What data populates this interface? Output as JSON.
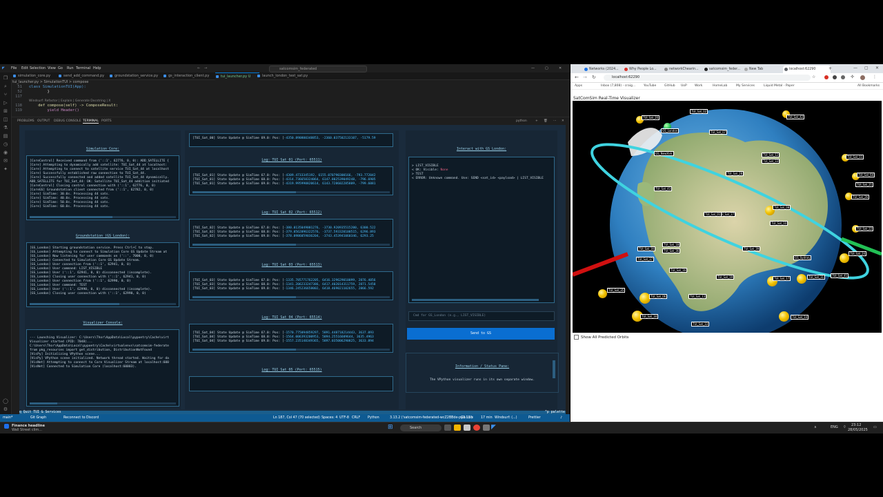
{
  "vscode": {
    "menu": [
      "File",
      "Edit",
      "Selection",
      "View",
      "Go",
      "Run",
      "Terminal",
      "Help"
    ],
    "search_placeholder": "satcomsim_federated",
    "tabs": [
      "simulation_core.py",
      "send_add_command.py",
      "groundstation_service.py",
      "gs_interaction_client.py",
      "tui_launcher.py U",
      "launch_london_test_sat.py"
    ],
    "breadcrumb": "tui_launcher.py > SimulationTUI > compose",
    "code_lines": [
      {
        "n": "51",
        "text": "class SimulationTUI(App):"
      },
      {
        "n": "52",
        "text": "        }"
      },
      {
        "n": "117",
        "text": ""
      },
      {
        "n": "",
        "text": "Windsurf: Refactor | Explain | Generate Docstring | X"
      },
      {
        "n": "118",
        "text": "    def compose(self) -> ComposeResult:"
      },
      {
        "n": "119",
        "text": "        yield Header()"
      }
    ],
    "panel_tabs": [
      "PROBLEMS",
      "OUTPUT",
      "DEBUG CONSOLE",
      "TERMINAL",
      "PORTS"
    ],
    "panel_right": "python",
    "quit_bar": "q Quit TUI & Services",
    "palette": "^p palette",
    "status": {
      "branch": "main*",
      "git": "Git Graph",
      "reconnect": "Reconnect to Discord",
      "pos": "Ln 187, Col 47 (70 selected)",
      "spaces": "Spaces: 4",
      "enc": "UTF-8",
      "eol": "CRLF",
      "lang": "Python",
      "interp": "3.13.2 ('satcomsim-federated-wcZ2BBde-py3.13')",
      "golive": "Go Live",
      "time": "17 min",
      "ws": "Windsurf: (...)",
      "prettier": "Prettier"
    }
  },
  "tui": {
    "sim_core": {
      "title": "Simulation Core:",
      "lines": [
        "[CoreControl] Received command from ('::1', 62776, 0, 0): ADD_SATELLITE {",
        "[Core] Attempting to dynamically add satellite: TUI_Sat_44 at localhost:",
        "[Core] Attempting to connect to satellite service TUI_Sat_44 at localhost",
        "[Core] Successfully established raw connection to TUI_Sat_44.",
        "[Core] Successfully connected and added satellite TUI_Sat_44 dynamically.",
        "ADD_SATELLITE for TUI_Sat_44: OK: Satellite TUI_Sat_44 addition initiated",
        "[CoreControl] Closing control connection with ('::1', 62776, 0, 0)",
        "[CoreGS] Groundstation client connected from ('::1', 62782, 0, 0)",
        "[Core] SimTime: 30.0s. Processing 44 sats.",
        "[Core] SimTime: 40.0s. Processing 44 sats.",
        "[Core] SimTime: 50.0s. Processing 44 sats.",
        "[Core] SimTime: 60.0s. Processing 44 sats."
      ]
    },
    "groundstation": {
      "title": "Groundstation (GS_London):",
      "lines": [
        "[GS_London] Starting groundstation service. Press Ctrl+C to stop.",
        "[GS_London] Attempting to connect to Simulation Core GS Update Stream at",
        "[GS_London] Now listening for user commands on ('::', 7000, 0, 0)",
        "[GS_London] Connected to Simulation Core GS Update Stream.",
        "[GS_London] User connection from ('::1', 62941, 0, 0)",
        "[GS_London] User command: LIST_VISIBLE",
        "[GS_London] User ('::1', 62941, 0, 0) disconnected (incomplete).",
        "[GS_London] Closing user connection with ('::1', 62941, 0, 0)",
        "[GS_London] User connection from ('::1', 62990, 0, 0)",
        "[GS_London] User command: TEST",
        "[GS_London] User ('::1', 62990, 0, 0) disconnected (incomplete).",
        "[GS_London] Closing user connection with ('::1', 62990, 0, 0)"
      ]
    },
    "visualizer": {
      "title": "Visualizer Console:",
      "lines": [
        "--- Launching Visualizer: C:\\Users\\Thor\\AppData\\Local\\pypoetry\\Cache\\virt",
        "Visualizer started (PID: 7048)...",
        "C:\\Users\\Thor\\AppData\\Local\\pypoetry\\Cache\\virtualenvs\\satcomsim-federate",
        "from pkg_resources import get_distribution, DistributionNotFound",
        "[VisPy] Initializing VPython scene...",
        "[VisPy] VPython scene initialized. Network thread started. Waiting for da",
        "[VisNet] Attempting to connect to Core Visualizer Stream at localhost:600",
        "[VisNet] Connected to Simulation Core (localhost:60003)."
      ]
    },
    "sat_logs": [
      {
        "title": "",
        "lines": [
          {
            "pre": "[TUI_Sat_00] State Update @ SimTime 69.0: Pos: [",
            "val": "-4350.890800348853, -2360.037502133107, -5179.59"
          }
        ]
      },
      {
        "title": "Log: TUI_Sat_01 (Port: 65511)",
        "lines": [
          {
            "pre": "[TUI_Sat_01] State Update @ SimTime 67.0: Pos: [",
            "val": "-4309.4733345192, 6155.070790300166, -793.772042"
          },
          {
            "pre": "[TUI_Sat_01] State Update @ SimTime 68.0: Pos: [",
            "val": "-4314.736658324064, 6147.802539049248, -796.6905"
          },
          {
            "pre": "[TUI_Sat_01] State Update @ SimTime 69.0: Pos: [",
            "val": "-4319.995990820614, 6143.728602285809, -799.6081"
          }
        ]
      },
      {
        "title": "Log: TUI_Sat_02 (Port: 65512)",
        "lines": [
          {
            "pre": "[TUI_Sat_02] State Update @ SimTime 67.0: Pos: [",
            "val": "-380.0135049001276, -3730.920935515200, 6300.522"
          },
          {
            "pre": "[TUI_Sat_02] State Update @ SimTime 68.0: Pos: [",
            "val": "-379.0562096322576, -3737.593320100515, 6296.893"
          },
          {
            "pre": "[TUI_Sat_02] State Update @ SimTime 69.0: Pos: [",
            "val": "-378.0986059036204, -3743.453941060346, 6293.25"
          }
        ]
      },
      {
        "title": "Log: TUI_Sat_03 (Port: 65513)",
        "lines": [
          {
            "pre": "[TUI_Sat_03] State Update @ SimTime 67.0: Pos: [",
            "val": "-1335.785771762205, 6416.329629010099, 2876.4056"
          },
          {
            "pre": "[TUI_Sat_03] State Update @ SimTime 68.0: Pos: [",
            "val": "-1341.206233247386, 6417.402014311759, 2871.5458"
          },
          {
            "pre": "[TUI_Sat_03] State Update @ SimTime 69.0: Pos: [",
            "val": "-1346.245236658002, 6418.469021102655, 2866.592"
          }
        ]
      },
      {
        "title": "Log: TUI_Sat_04 (Port: 65514)",
        "lines": [
          {
            "pre": "[TUI_Sat_04] State Update @ SimTime 67.0: Pos: [",
            "val": "-1570.775094859297, 5891.448718214443, 3637.093"
          },
          {
            "pre": "[TUI_Sat_04] State Update @ SimTime 68.0: Pos: [",
            "val": "-1564.006393200953, 5894.25516609644, 3635.4963"
          },
          {
            "pre": "[TUI_Sat_04] State Update @ SimTime 69.0: Pos: [",
            "val": "-1557.235148349365, 5897.035006290825, 3633.894"
          }
        ]
      },
      {
        "title": "Log: TUI_Sat_05 (Port: 65515)",
        "lines": []
      }
    ],
    "interact": {
      "title": "Interact with GS_London:",
      "lines": [
        {
          "text": "> LIST_VISIBLE",
          "extra": ""
        },
        {
          "text": "< OK: Visible: ",
          "extra": "None"
        },
        {
          "text": "> TEST",
          "extra": ""
        },
        {
          "text": "< ERROR: Unknown command. Use: SEND <sat_id> <payload> | LIST_VISIBLE",
          "extra": ""
        }
      ],
      "input_placeholder": "Cmd for GS_London (e.g., LIST_VISIBLE)",
      "send_button": "Send to GS",
      "info_title": "Information / Status Pane:",
      "info_text": "The VPython visualizer runs in its own separate window."
    }
  },
  "chrome": {
    "tabs": [
      "Networks (2024...",
      "Why People Lo...",
      "networkChearin...",
      "satcomsim_feder...",
      "New Tab",
      "localhost:62290"
    ],
    "url": "localhost:62290",
    "bookmarks": [
      "Apps",
      "Inbox (7,808) - craig...",
      "YouTube",
      "GitHub",
      "UoP",
      "Work",
      "HomeLab",
      "My Services",
      "Liquid Metal - Paper",
      "All Bookmarks"
    ],
    "page_title": "SatComSim Real-Time Visualizer",
    "show_orbits": "Show All Predicted Orbits",
    "satellites": [
      "TUI_Sat_20",
      "TUI_Sat_02",
      "TUI_Sat_42",
      "GS_London",
      "TUI_Sat_07",
      "GS_NewYork",
      "TUI_Sat_12",
      "TUI_Sat_33",
      "TUI_Sat_28",
      "TUI_Sat_43",
      "TUI_Sat_11",
      "TUI_Sat_64",
      "TUI_Sat_21",
      "TUI_Sat_26",
      "TUI_Sat_08",
      "TUI_Sat_10",
      "TUI_Sat_27",
      "TUI_Sat_01",
      "TUI_Sat_22",
      "TUI_Sat_30",
      "TUI_Sat_18",
      "TUI_Sat_36",
      "TUI_Sat_37",
      "TUI_Sat_39",
      "GS_Sydney",
      "TUI_Sat_24",
      "TUI_Sat_16",
      "TUI_Sat_19",
      "TUI_Sat_13",
      "TUI_Sat_17",
      "TUI_Sat_31",
      "TUI_Sat_41",
      "TUI_Sat_35",
      "TUI_Sat_06",
      "TUI_Sat_34",
      "TUI_Sat_33",
      "TUI_Sat_14"
    ]
  },
  "taskbar": {
    "news_title": "Finance headline",
    "news_sub": "Wall Street clim...",
    "search": "Search",
    "lang": "ENG",
    "time": "23:12",
    "date": "28/05/2025"
  }
}
